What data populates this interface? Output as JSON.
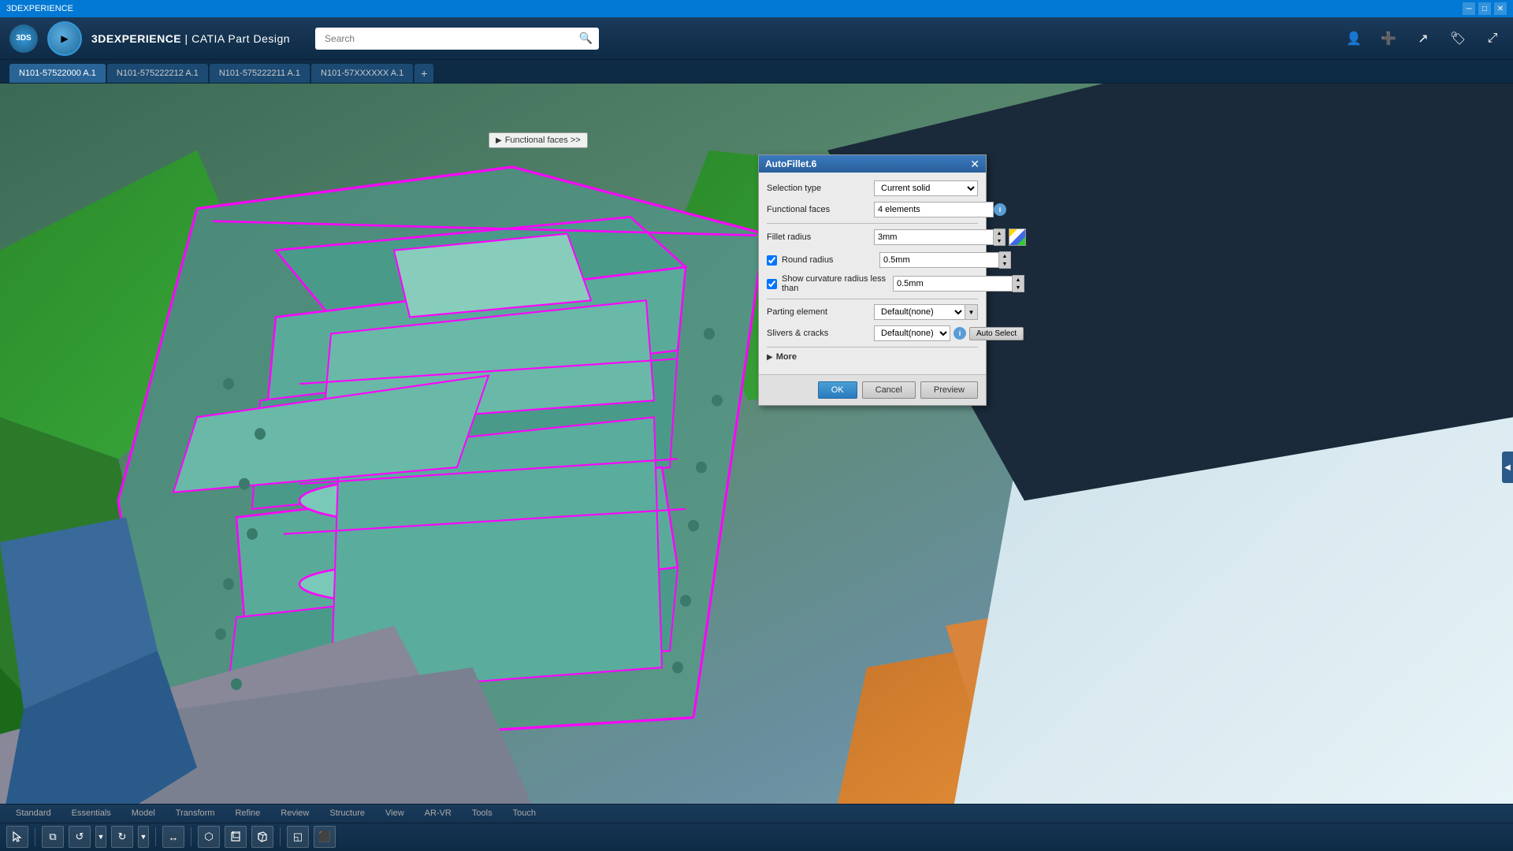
{
  "titlebar": {
    "title": "3DEXPERIENCE",
    "controls": {
      "minimize": "─",
      "maximize": "□",
      "close": "✕"
    }
  },
  "toolbar": {
    "brand": "3DS",
    "app_name": "3DEXPERIENCE",
    "separator": "|",
    "product": "CATIA",
    "module": "Part Design",
    "search_placeholder": "Search",
    "search_label": "Search"
  },
  "tabs": [
    {
      "id": "tab1",
      "label": "N101-57522000 A.1",
      "active": true
    },
    {
      "id": "tab2",
      "label": "N101-575222212 A.1",
      "active": false
    },
    {
      "id": "tab3",
      "label": "N101-575222211 A.1",
      "active": false
    },
    {
      "id": "tab4",
      "label": "N101-57XXXXXX A.1",
      "active": false
    }
  ],
  "functional_faces_label": "Functional faces >>",
  "dialog": {
    "title": "AutoFillet.6",
    "close_btn": "✕",
    "fields": {
      "selection_type_label": "Selection type",
      "selection_type_value": "Current solid",
      "functional_faces_label": "Functional faces",
      "functional_faces_value": "4 elements",
      "fillet_radius_label": "Fillet radius",
      "fillet_radius_value": "3mm",
      "round_radius_label": "Round radius",
      "round_radius_value": "0.5mm",
      "round_radius_checked": true,
      "show_curvature_label": "Show curvature radius less than",
      "show_curvature_value": "0.5mm",
      "show_curvature_checked": true,
      "parting_element_label": "Parting element",
      "parting_element_value": "Default(none)",
      "slivers_label": "Slivers & cracks",
      "slivers_value": "Default(none)",
      "auto_select_label": "Auto Select",
      "more_label": "More"
    },
    "buttons": {
      "ok": "OK",
      "cancel": "Cancel",
      "preview": "Preview"
    }
  },
  "bottom_toolbar": {
    "tabs": [
      {
        "label": "Standard",
        "active": false
      },
      {
        "label": "Essentials",
        "active": false
      },
      {
        "label": "Model",
        "active": false
      },
      {
        "label": "Transform",
        "active": false
      },
      {
        "label": "Refine",
        "active": false
      },
      {
        "label": "Review",
        "active": false
      },
      {
        "label": "Structure",
        "active": false
      },
      {
        "label": "View",
        "active": false
      },
      {
        "label": "AR-VR",
        "active": false
      },
      {
        "label": "Tools",
        "active": false
      },
      {
        "label": "Touch",
        "active": false
      }
    ],
    "icons": [
      "↩",
      "⧉",
      "↺",
      "↻",
      "⊕",
      "↔",
      "⬡",
      "⬢",
      "⬣",
      "◱",
      "⬛"
    ]
  }
}
